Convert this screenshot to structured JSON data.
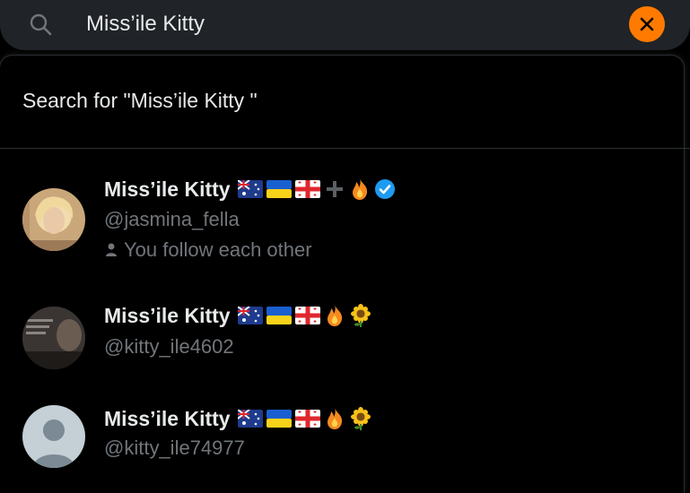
{
  "search": {
    "query": "Miss’ile Kitty",
    "clear_icon": "close-icon",
    "search_icon": "search-icon",
    "accent_color": "#ff7a00"
  },
  "dropdown": {
    "search_for_label": "Search for \"Miss’ile Kitty \""
  },
  "results": [
    {
      "name": "Miss’ile Kitty",
      "handle": "@jasmina_fella",
      "social_context": "You follow each other",
      "verified": true,
      "emojis": [
        "australia-flag-icon",
        "ukraine-flag-icon",
        "georgia-flag-icon",
        "plus-icon",
        "fire-icon"
      ]
    },
    {
      "name": "Miss’ile Kitty",
      "handle": "@kitty_ile4602",
      "emojis": [
        "australia-flag-icon",
        "ukraine-flag-icon",
        "georgia-flag-icon",
        "fire-icon",
        "sunflower-icon"
      ]
    },
    {
      "name": "Miss’ile Kitty",
      "handle": "@kitty_ile74977",
      "emojis": [
        "australia-flag-icon",
        "ukraine-flag-icon",
        "georgia-flag-icon",
        "fire-icon",
        "sunflower-icon"
      ]
    }
  ]
}
